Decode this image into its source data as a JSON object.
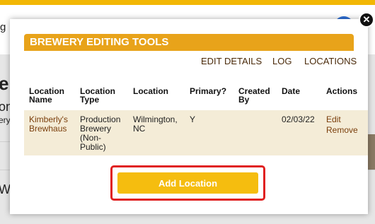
{
  "background": {
    "left_fragments": [
      "g",
      "er",
      "on,",
      "ery",
      "Wi"
    ]
  },
  "modal": {
    "title": "BREWERY EDITING TOOLS",
    "tabs": [
      "EDIT DETAILS",
      "LOG",
      "LOCATIONS"
    ],
    "table": {
      "headers": [
        "Location Name",
        "Location Type",
        "Location",
        "Primary?",
        "Created By",
        "Date",
        "Actions"
      ],
      "rows": [
        {
          "name_line1": "Kimberly's",
          "name_line2": "Brewhaus",
          "type_line1": "Production",
          "type_line2": "Brewery",
          "type_line3": "(Non-",
          "type_line4": "Public)",
          "location_line1": "Wilmington,",
          "location_line2": "NC",
          "primary": "Y",
          "created_by": "",
          "date": "02/03/22",
          "action_edit": "Edit",
          "action_remove": "Remove"
        }
      ]
    },
    "add_button_label": "Add Location",
    "close_symbol": "✕"
  },
  "colors": {
    "accent_yellow": "#f5bd0f",
    "title_bar": "#e8a31a",
    "row_highlight": "#f4ecd7",
    "link_brown": "#7a3e0b",
    "highlight_red": "#e02020"
  }
}
